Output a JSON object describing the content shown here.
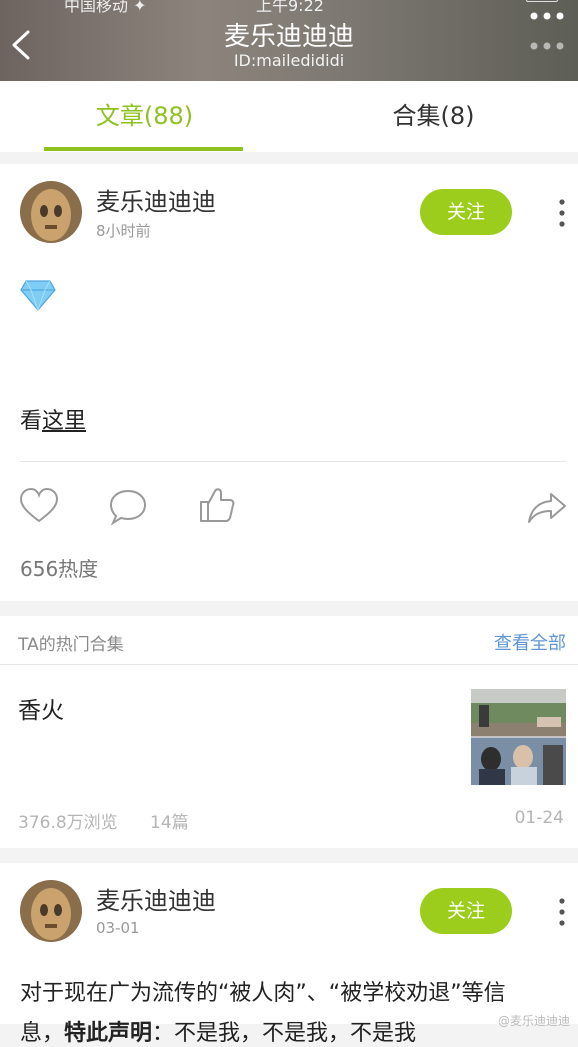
{
  "status_bar": {
    "carrier": "中国移动 ✦",
    "clock": "上午9:22"
  },
  "header": {
    "title": "麦乐迪迪迪",
    "subtitle": "ID:mailedididi",
    "back_icon": "chevron-left-icon",
    "more_icon": "more-dots-icon"
  },
  "tabs": [
    {
      "label": "文章(88)",
      "active": true
    },
    {
      "label": "合集(8)",
      "active": false
    }
  ],
  "post1": {
    "author": "麦乐迪迪迪",
    "time": "8小时前",
    "follow_label": "关注",
    "emoji_icon": "diamond-icon",
    "text_prefix": "看",
    "link_text": "这里",
    "actions": [
      "heart-icon",
      "comment-icon",
      "thumbs-up-icon",
      "share-icon"
    ],
    "heat": "656热度"
  },
  "collections": {
    "title": "TA的热门合集",
    "view_all": "查看全部",
    "item": {
      "name": "香火",
      "views": "376.8万浏览",
      "count": "14篇",
      "date": "01-24"
    }
  },
  "post2": {
    "author": "麦乐迪迪迪",
    "time": "03-01",
    "follow_label": "关注",
    "line1": "对于现在广为流传的“被人肉”、“被学校劝退”等信",
    "line2_a": "息，",
    "line2_b": "特此声明",
    "line2_c": "：不是我，不是我，不是我"
  },
  "watermark": "@麦乐迪迪迪",
  "colors": {
    "accent": "#8ec21f",
    "follow_bg": "#9ccc1c",
    "link": "#5e96d6"
  }
}
